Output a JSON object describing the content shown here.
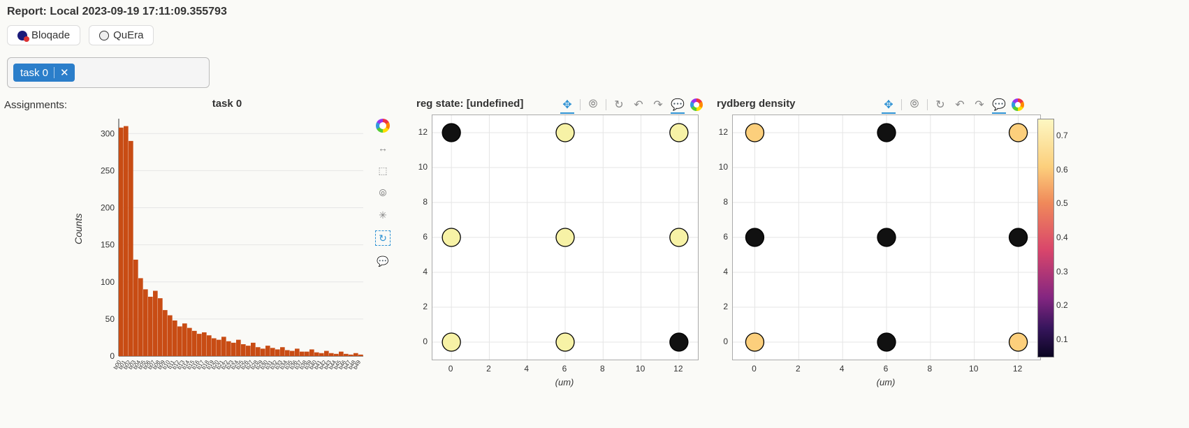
{
  "header": {
    "title": "Report: Local 2023-09-19 17:11:09.355793"
  },
  "buttons": {
    "bloqade": "Bloqade",
    "quera": "QuEra"
  },
  "chip": {
    "label": "task 0",
    "close": "✕"
  },
  "assignments_label": "Assignments:",
  "bar_chart": {
    "title": "task 0",
    "ylabel": "Counts"
  },
  "panel1": {
    "title": "reg state: [undefined]",
    "xlabel": "(um)",
    "x_ticks": [
      "0",
      "2",
      "4",
      "6",
      "8",
      "10",
      "12"
    ],
    "y_ticks": [
      "0",
      "2",
      "4",
      "6",
      "8",
      "10",
      "12"
    ]
  },
  "panel2": {
    "title": "rydberg density",
    "xlabel": "(um)",
    "x_ticks": [
      "0",
      "2",
      "4",
      "6",
      "8",
      "10",
      "12"
    ],
    "y_ticks": [
      "0",
      "2",
      "4",
      "6",
      "8",
      "10",
      "12"
    ]
  },
  "colorbar": {
    "ticks": [
      "0.7",
      "0.6",
      "0.5",
      "0.4",
      "0.3",
      "0.2",
      "0.1"
    ]
  },
  "chart_data": [
    {
      "type": "bar",
      "title": "task 0",
      "ylabel": "Counts",
      "ylim": [
        0,
        320
      ],
      "y_ticks": [
        0,
        50,
        100,
        150,
        200,
        250,
        300
      ],
      "categories": [
        "b00",
        "b01",
        "b02",
        "b03",
        "b04",
        "b05",
        "b06",
        "b07",
        "b08",
        "b09",
        "b10",
        "b11",
        "b12",
        "b13",
        "b14",
        "b15",
        "b16",
        "b17",
        "b18",
        "b19",
        "b20",
        "b21",
        "b22",
        "b23",
        "b24",
        "b25",
        "b26",
        "b27",
        "b28",
        "b29",
        "b30",
        "b31",
        "b32",
        "b33",
        "b34",
        "b35",
        "b36",
        "b37",
        "b38",
        "b39",
        "b40",
        "b41",
        "b42",
        "b43",
        "b44",
        "b45",
        "b46",
        "b47",
        "b48",
        "b49"
      ],
      "values": [
        308,
        310,
        290,
        130,
        105,
        90,
        80,
        88,
        78,
        62,
        55,
        48,
        40,
        44,
        38,
        34,
        30,
        32,
        28,
        24,
        22,
        26,
        20,
        18,
        22,
        16,
        14,
        18,
        12,
        10,
        14,
        11,
        9,
        12,
        8,
        7,
        10,
        6,
        6,
        9,
        5,
        4,
        7,
        4,
        3,
        6,
        3,
        2,
        4,
        2
      ]
    },
    {
      "type": "scatter",
      "title": "reg state: [undefined]",
      "xlabel": "(um)",
      "ylabel": "",
      "xlim": [
        -1,
        13
      ],
      "ylim": [
        -1,
        13
      ],
      "series": [
        {
          "name": "dark",
          "x": [
            0,
            12
          ],
          "y": [
            12,
            0
          ]
        },
        {
          "name": "light",
          "x": [
            6,
            12,
            0,
            6,
            12,
            0,
            6
          ],
          "y": [
            12,
            12,
            6,
            6,
            6,
            0,
            0
          ]
        }
      ]
    },
    {
      "type": "scatter",
      "title": "rydberg density",
      "xlabel": "(um)",
      "ylabel": "",
      "xlim": [
        -1,
        13
      ],
      "ylim": [
        -1,
        13
      ],
      "x": [
        0,
        6,
        12,
        0,
        6,
        12,
        0,
        6,
        12
      ],
      "y": [
        12,
        12,
        12,
        6,
        6,
        6,
        0,
        0,
        0
      ],
      "density": [
        0.72,
        0.05,
        0.68,
        0.05,
        0.05,
        0.05,
        0.7,
        0.05,
        0.74
      ]
    }
  ]
}
